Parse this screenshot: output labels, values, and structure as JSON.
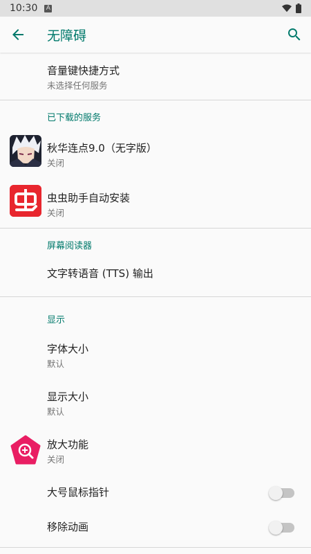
{
  "status_bar": {
    "time": "10:30",
    "notification_icon": "A"
  },
  "toolbar": {
    "title": "无障碍"
  },
  "shortcut": {
    "title": "音量键快捷方式",
    "subtitle": "未选择任何服务"
  },
  "downloaded": {
    "header": "已下载的服务",
    "items": [
      {
        "title": "秋华连点9.0（无字版）",
        "subtitle": "关闭"
      },
      {
        "title": "虫虫助手自动安装",
        "subtitle": "关闭"
      }
    ]
  },
  "screen_reader": {
    "header": "屏幕阅读器",
    "tts": "文字转语音 (TTS) 输出"
  },
  "display": {
    "header": "显示",
    "font_size": {
      "title": "字体大小",
      "subtitle": "默认"
    },
    "display_size": {
      "title": "显示大小",
      "subtitle": "默认"
    },
    "magnification": {
      "title": "放大功能",
      "subtitle": "关闭"
    },
    "large_pointer": {
      "title": "大号鼠标指针",
      "enabled": false
    },
    "remove_animations": {
      "title": "移除动画",
      "enabled": false
    }
  },
  "icons": {
    "back": "arrow-back-icon",
    "search": "search-icon",
    "app1": "anime-avatar-icon",
    "app2": "chongchong-icon",
    "magnify": "magnification-icon"
  },
  "colors": {
    "accent": "#00796b",
    "divider": "#d6d6d6",
    "chongchong_red": "#e8262e",
    "magnify_pink": "#e91e63"
  }
}
